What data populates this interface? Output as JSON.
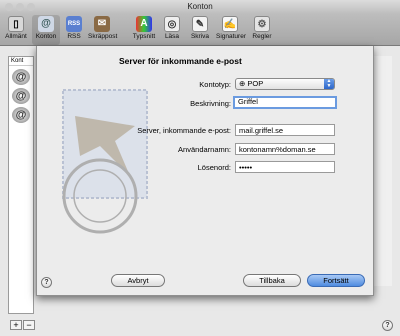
{
  "window": {
    "title": "Konton"
  },
  "toolbar": {
    "items": [
      {
        "label": "Allmänt"
      },
      {
        "label": "Konton"
      },
      {
        "label": "RSS"
      },
      {
        "label": "Skräppost"
      },
      {
        "label": "Typsnitt"
      },
      {
        "label": "Läsa"
      },
      {
        "label": "Skriva"
      },
      {
        "label": "Signaturer"
      },
      {
        "label": "Regler"
      }
    ]
  },
  "sidebar": {
    "header": "Kont"
  },
  "sheet": {
    "heading": "Server för inkommande e-post",
    "account_type_label": "Kontotyp:",
    "account_type_value": "POP",
    "description_label": "Beskrivning:",
    "description_value": "Griffel",
    "server_label": "Server, inkommande e-post:",
    "server_value": "mail.griffel.se",
    "username_label": "Användarnamn:",
    "username_value": "kontonamn%doman.se",
    "password_label": "Lösenord:",
    "password_value": "•••••",
    "cancel_label": "Avbryt",
    "back_label": "Tillbaka",
    "continue_label": "Fortsätt",
    "help_label": "?"
  },
  "bottom": {
    "add_label": "+",
    "remove_label": "−",
    "help_label": "?"
  }
}
